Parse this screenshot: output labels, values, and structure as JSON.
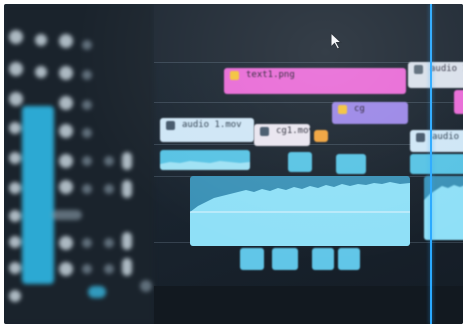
{
  "photo": {
    "subject": "video editing timeline on a monitor",
    "colors": {
      "image_clip": "#e86ad6",
      "video_clip": "#cfd9f7",
      "audio_clip": "#57c3e4",
      "playhead": "#2aa9ff",
      "selection": "#2fb8e6"
    }
  },
  "timeline": {
    "clips": [
      {
        "label": "text1.png",
        "kind": "image"
      },
      {
        "label": "cg",
        "kind": "image"
      },
      {
        "label": "cg1.mov",
        "kind": "video"
      },
      {
        "label": "audio 1.mov",
        "kind": "video"
      },
      {
        "label": "audio 1.mov",
        "kind": "video"
      },
      {
        "label": "audio 1.mov",
        "kind": "video"
      }
    ]
  },
  "icons": {
    "cursor": "arrow-cursor-icon"
  }
}
